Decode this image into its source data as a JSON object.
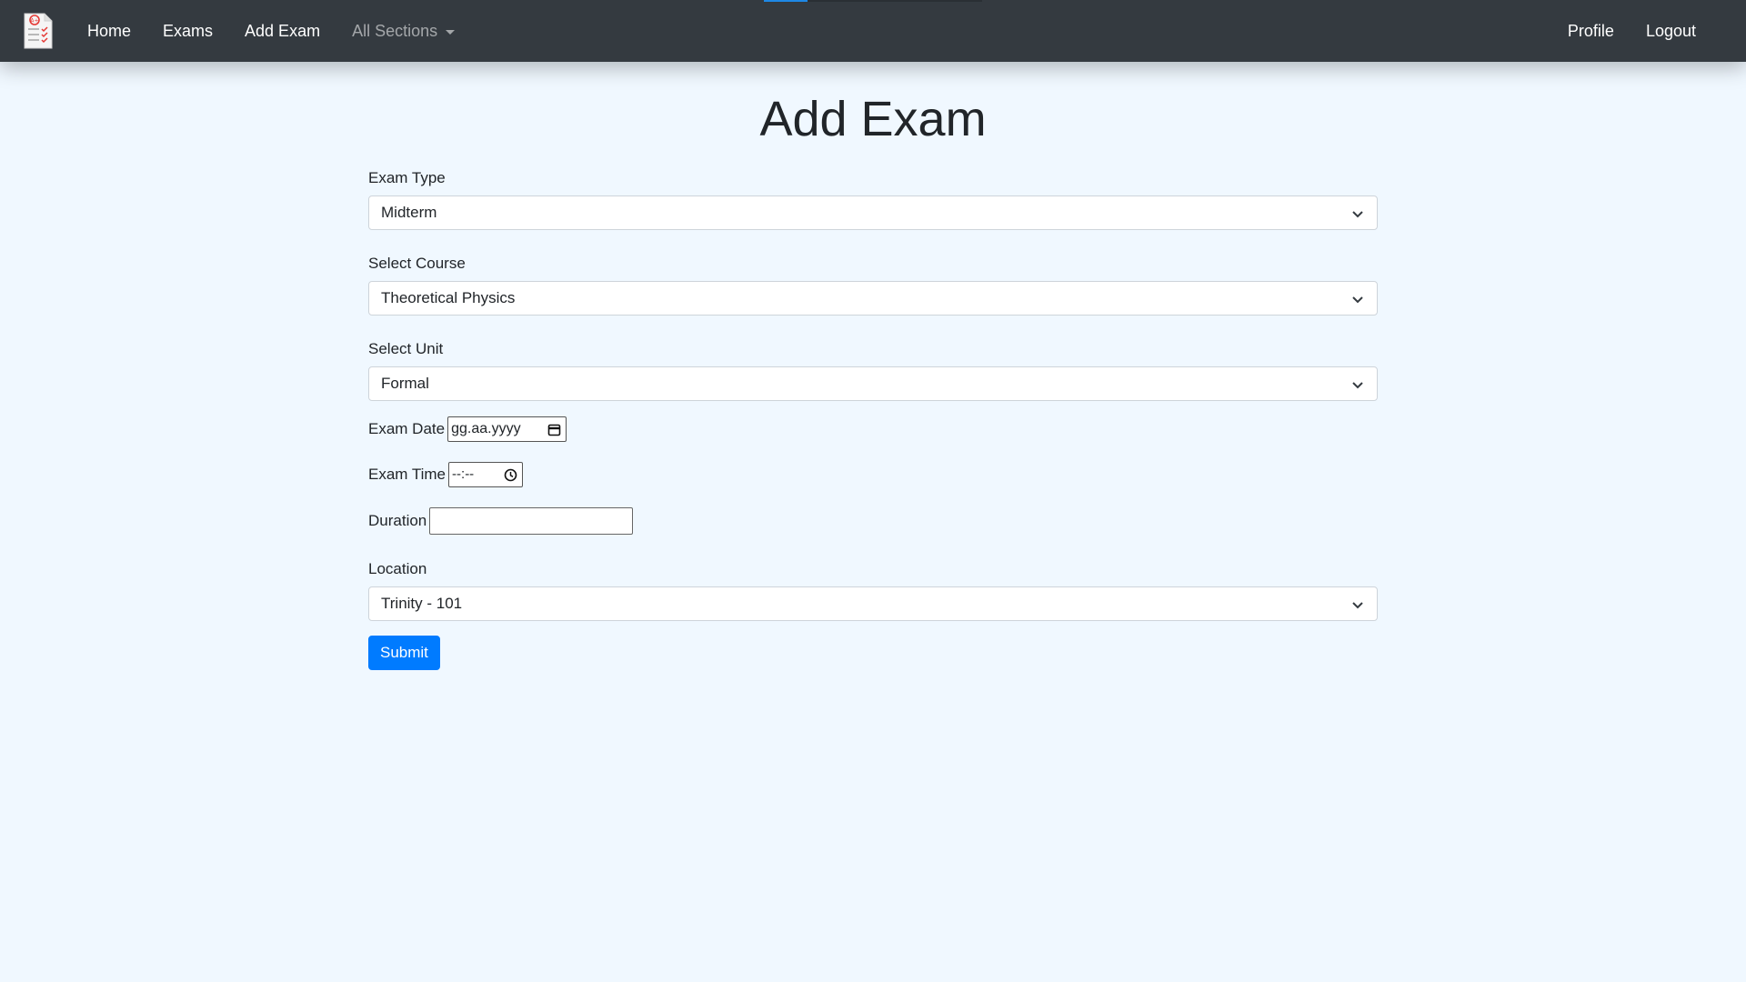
{
  "nav": {
    "links": [
      "Home",
      "Exams",
      "Add Exam",
      "All Sections"
    ],
    "right_links": [
      "Profile",
      "Logout"
    ]
  },
  "page": {
    "title": "Add Exam"
  },
  "form": {
    "exam_type": {
      "label": "Exam Type",
      "value": "Midterm"
    },
    "course": {
      "label": "Select Course",
      "value": "Theoretical Physics"
    },
    "unit": {
      "label": "Select Unit",
      "value": "Formal"
    },
    "exam_date": {
      "label": "Exam Date",
      "placeholder": "gg.aa.yyyy"
    },
    "exam_time": {
      "label": "Exam Time",
      "placeholder": "--:--"
    },
    "duration": {
      "label": "Duration",
      "value": ""
    },
    "location": {
      "label": "Location",
      "value": "Trinity - 101"
    },
    "submit_label": "Submit"
  },
  "colors": {
    "navbar": "#343a40",
    "background": "#f0f8ff",
    "primary": "#007bff"
  },
  "icons": {
    "brand": "exam-checklist-logo",
    "select": "chevron-down",
    "date": "calendar",
    "time": "clock"
  }
}
